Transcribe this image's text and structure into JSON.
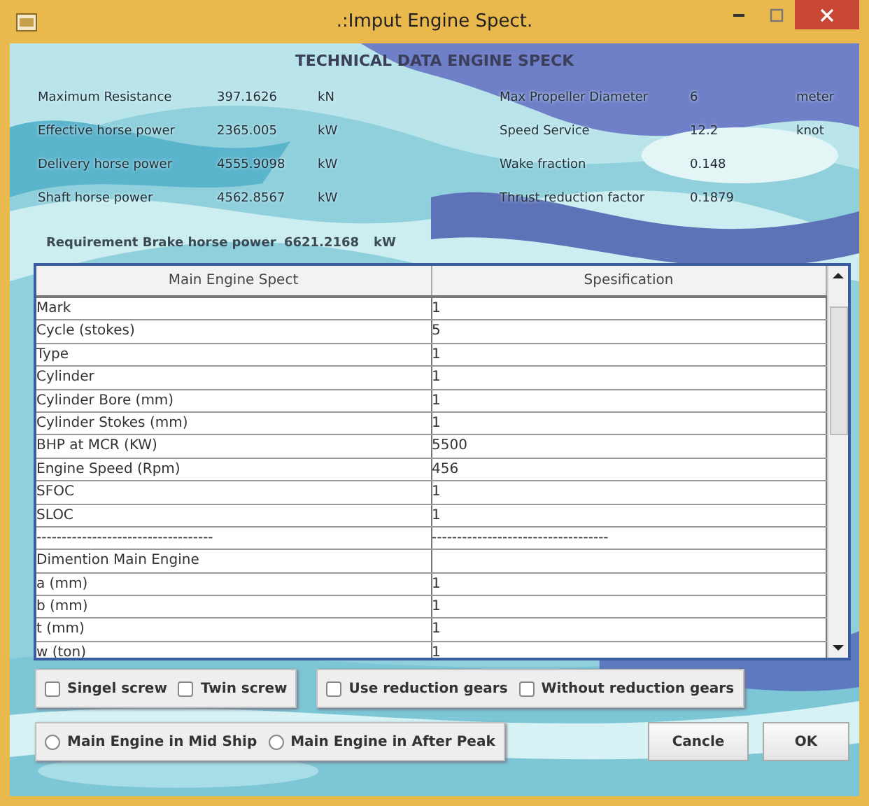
{
  "window": {
    "title": ".:Imput Engine Spect."
  },
  "heading": "TECHNICAL DATA ENGINE SPECK",
  "left_fields": [
    {
      "label": "Maximum Resistance",
      "value": "397.1626",
      "unit": "kN"
    },
    {
      "label": "Effective horse power",
      "value": "2365.005",
      "unit": "kW"
    },
    {
      "label": "Delivery horse power",
      "value": "4555.9098",
      "unit": "kW"
    },
    {
      "label": "Shaft horse power",
      "value": "4562.8567",
      "unit": "kW"
    }
  ],
  "right_fields": [
    {
      "label": "Max Propeller Diameter",
      "value": "6",
      "unit": "meter"
    },
    {
      "label": "Speed Service",
      "value": "12.2",
      "unit": "knot"
    },
    {
      "label": "Wake fraction",
      "value": "0.148"
    },
    {
      "label": "Thrust reduction factor",
      "value": "0.1879"
    }
  ],
  "requirement": {
    "label": "Requirement Brake horse power",
    "value": "6621.2168",
    "unit": "kW"
  },
  "table": {
    "columns": [
      "Main Engine Spect",
      "Spesification"
    ],
    "rows": [
      [
        "Mark",
        "1"
      ],
      [
        "Cycle (stokes)",
        "5"
      ],
      [
        "Type",
        "1"
      ],
      [
        "Cylinder",
        "1"
      ],
      [
        "Cylinder Bore (mm)",
        "1"
      ],
      [
        "Cylinder Stokes (mm)",
        "1"
      ],
      [
        "BHP at MCR (KW)",
        "5500"
      ],
      [
        "Engine Speed (Rpm)",
        "456"
      ],
      [
        "SFOC",
        "1"
      ],
      [
        "SLOC",
        "1"
      ],
      [
        "-----------------------------------",
        "-----------------------------------"
      ],
      [
        "Dimention Main Engine",
        ""
      ],
      [
        "a (mm)",
        "1"
      ],
      [
        "b (mm)",
        "1"
      ],
      [
        "t (mm)",
        "1"
      ],
      [
        "w (ton)",
        "1"
      ]
    ]
  },
  "option_groups": [
    [
      {
        "kind": "checkbox",
        "label": "Singel screw",
        "checked": false
      },
      {
        "kind": "checkbox",
        "label": "Twin screw",
        "checked": false
      }
    ],
    [
      {
        "kind": "checkbox",
        "label": "Use reduction gears",
        "checked": false
      },
      {
        "kind": "checkbox",
        "label": "Without reduction gears",
        "checked": false
      }
    ],
    [
      {
        "kind": "radio",
        "label": "Main Engine in Mid Ship",
        "checked": false
      },
      {
        "kind": "radio",
        "label": "Main Engine in After Peak",
        "checked": false
      }
    ]
  ],
  "buttons": [
    "Cancle",
    "OK"
  ]
}
